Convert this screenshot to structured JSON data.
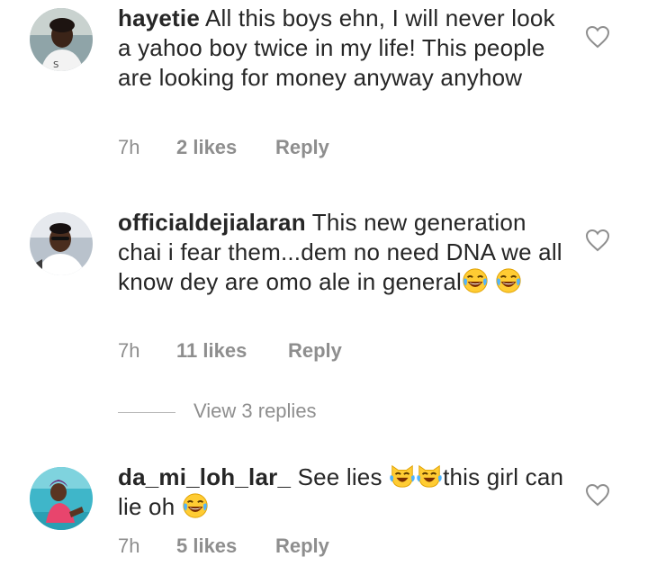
{
  "comments": [
    {
      "username": "hayetie",
      "text": "All this boys ehn, I will never look a yahoo boy twice in my life! This people are looking for money anyway anyhow",
      "time": "7h",
      "likes": "2 likes",
      "reply": "Reply"
    },
    {
      "username": "officialdejialaran",
      "text": "This new generation chai i fear them...dem no need DNA we all know dey are omo ale in general",
      "time": "7h",
      "likes": "11 likes",
      "reply": "Reply",
      "view_replies": "View 3 replies"
    },
    {
      "username": "da_mi_loh_lar_",
      "text_part1": "See lies ",
      "text_part2": "this girl can lie oh ",
      "time": "7h",
      "likes": "5 likes",
      "reply": "Reply"
    }
  ],
  "icons": {
    "like": "heart-outline-icon",
    "emoji_laugh": "face-with-tears-of-joy-emoji",
    "emoji_cat": "cat-with-tears-of-joy-emoji"
  },
  "colors": {
    "text": "#262626",
    "meta": "#8e8e8e",
    "emoji": "#ffcc33"
  }
}
